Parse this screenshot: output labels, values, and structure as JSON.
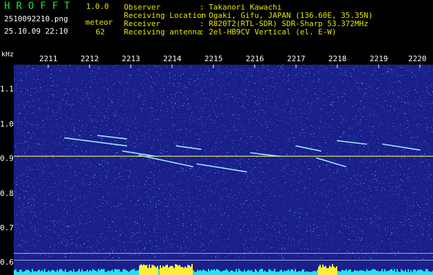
{
  "app": {
    "title": "HROFFT",
    "version": "1.0.0"
  },
  "file": {
    "name": "2510092210.png",
    "datetime": "25.10.09 22:10"
  },
  "meteor": {
    "label": "meteor",
    "count": "62"
  },
  "info": [
    {
      "label": "Observer",
      "value": ": Takanori Kawachi"
    },
    {
      "label": "Receiving Location",
      "value": ": Ogaki, Gifu, JAPAN (136.60E, 35.35N)"
    },
    {
      "label": "Receiver",
      "value": ": R820T2(RTL-SDR) SDR-Sharp 53.372MHz"
    },
    {
      "label": "Receiving antenna",
      "value": ": 2el-HB9CV Vertical (el. E-W)"
    }
  ],
  "axis": {
    "y_unit": "kHz",
    "x_ticks": [
      "2211",
      "2212",
      "2213",
      "2214",
      "2215",
      "2216",
      "2217",
      "2218",
      "2219",
      "2220"
    ],
    "y_ticks": [
      "1.1",
      "1.0",
      "0.9",
      "0.8",
      "0.7",
      "0.6"
    ]
  },
  "spectrogram": {
    "carrier_khz": 0.905,
    "freq_range_khz": [
      0.57,
      1.17
    ],
    "meteor_traces": [
      {
        "t0": 2211.4,
        "f0": 0.958,
        "t1": 2212.9,
        "f1": 0.935
      },
      {
        "t0": 2212.2,
        "f0": 0.965,
        "t1": 2212.9,
        "f1": 0.955
      },
      {
        "t0": 2213.2,
        "f0": 0.908,
        "t1": 2214.5,
        "f1": 0.875
      },
      {
        "t0": 2214.6,
        "f0": 0.883,
        "t1": 2215.8,
        "f1": 0.86
      },
      {
        "t0": 2214.1,
        "f0": 0.935,
        "t1": 2214.7,
        "f1": 0.925
      },
      {
        "t0": 2215.9,
        "f0": 0.915,
        "t1": 2216.6,
        "f1": 0.905
      },
      {
        "t0": 2217.0,
        "f0": 0.935,
        "t1": 2217.6,
        "f1": 0.92
      },
      {
        "t0": 2217.5,
        "f0": 0.9,
        "t1": 2218.2,
        "f1": 0.875
      },
      {
        "t0": 2218.0,
        "f0": 0.95,
        "t1": 2218.7,
        "f1": 0.94
      },
      {
        "t0": 2219.1,
        "f0": 0.94,
        "t1": 2220.0,
        "f1": 0.923
      },
      {
        "t0": 2212.8,
        "f0": 0.92,
        "t1": 2213.6,
        "f1": 0.905
      }
    ],
    "colors": {
      "background": "#1a1f8a",
      "noise": "#3a6ad8",
      "trace": "#9fe8ff",
      "carrier": "#e6e070",
      "histogram_base": "#19e6f0",
      "histogram_peak": "#ffee33"
    }
  }
}
